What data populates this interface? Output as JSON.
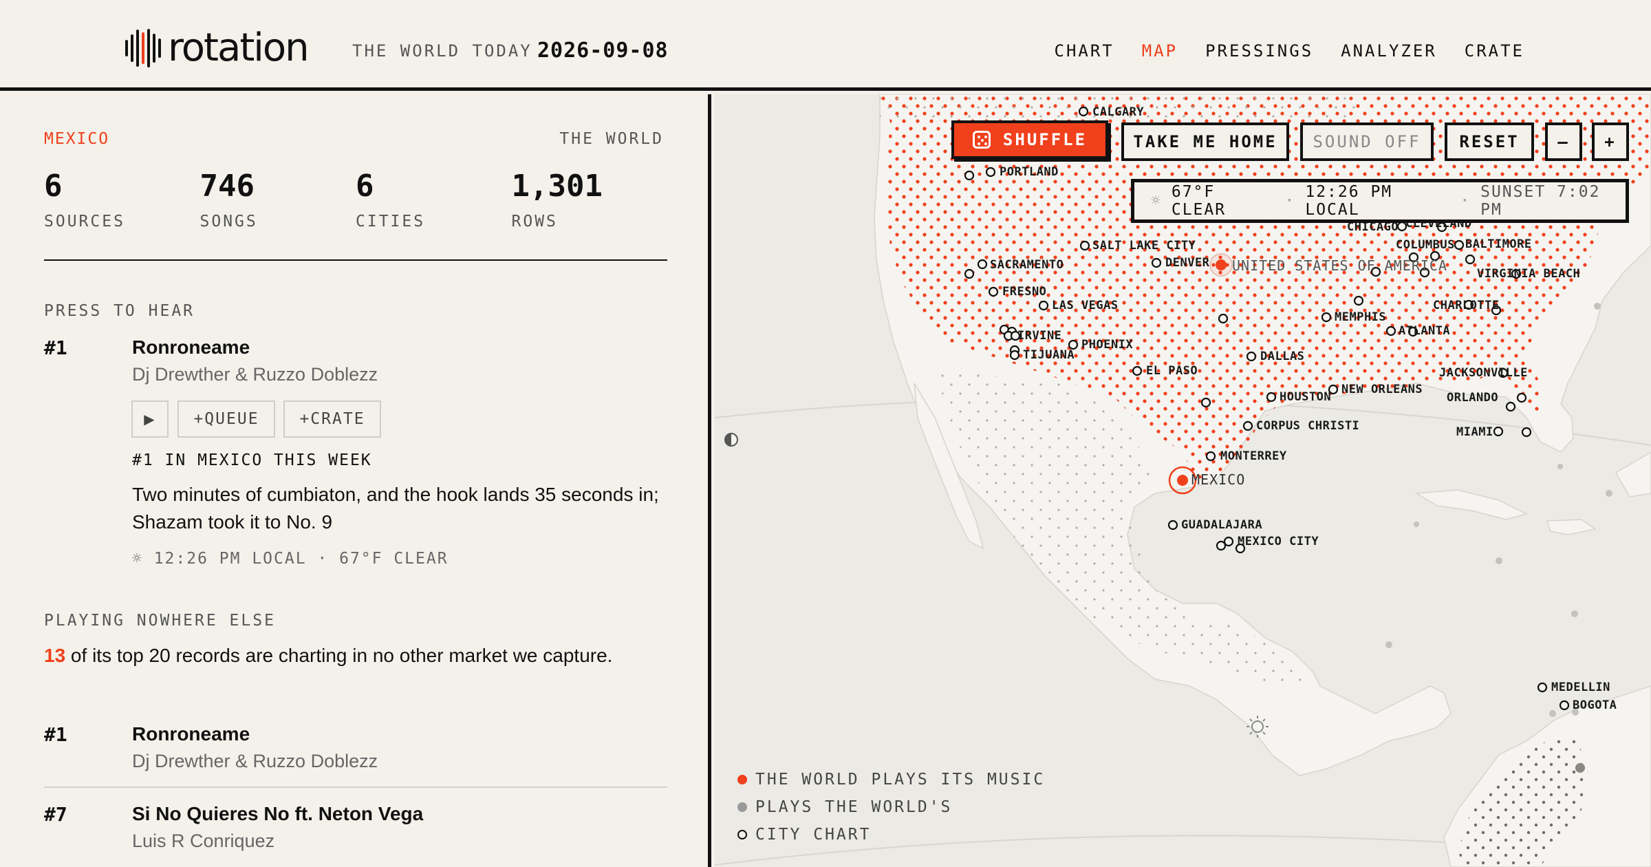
{
  "header": {
    "logo_text": "rotation",
    "tagline": "THE WORLD TODAY",
    "date": "2026-09-08",
    "nav": [
      {
        "label": "CHART",
        "active": false
      },
      {
        "label": "MAP",
        "active": true
      },
      {
        "label": "PRESSINGS",
        "active": false
      },
      {
        "label": "ANALYZER",
        "active": false
      },
      {
        "label": "CRATE",
        "active": false
      }
    ]
  },
  "panel": {
    "country": "MEXICO",
    "world_link": "THE WORLD",
    "stats": [
      {
        "value": "6",
        "label": "SOURCES"
      },
      {
        "value": "746",
        "label": "SONGS"
      },
      {
        "value": "6",
        "label": "CITIES"
      },
      {
        "value": "1,301",
        "label": "ROWS"
      }
    ],
    "press_to_hear": {
      "section_label": "PRESS TO HEAR",
      "rank": "#1",
      "title": "Ronroneame",
      "artist": "Dj Drewther & Ruzzo Doblezz",
      "play_icon": "▶",
      "queue_label": "+QUEUE",
      "crate_label": "+CRATE",
      "week_label": "#1 IN MEXICO THIS WEEK",
      "blurb": "Two minutes of cumbiaton, and the hook lands 35 seconds in; Shazam took it to No. 9",
      "local_line": "☼ 12:26 PM LOCAL · 67°F CLEAR"
    },
    "nowhere": {
      "section_label": "PLAYING NOWHERE ELSE",
      "count": "13",
      "text": " of its top 20 records are charting in no other market we capture.",
      "rows": [
        {
          "rank": "#1",
          "title": "Ronroneame",
          "artist": "Dj Drewther & Ruzzo Doblezz"
        },
        {
          "rank": "#7",
          "title": "Si No Quieres No ft. Neton Vega",
          "artist": "Luis R Conriquez"
        }
      ]
    }
  },
  "map": {
    "buttons": {
      "shuffle": "SHUFFLE",
      "home": "TAKE ME HOME",
      "sound": "SOUND OFF",
      "reset": "RESET",
      "zoom_out": "–",
      "zoom_in": "+"
    },
    "weather": {
      "icon": "☼",
      "temp": "67°F CLEAR",
      "local": "12:26 PM LOCAL",
      "sunset": "SUNSET 7:02 PM"
    },
    "colors": {
      "accent": "#f0401c",
      "ink": "#111111",
      "land": "#f5f4f0",
      "sea": "#ebeae5"
    },
    "country_labels": [
      {
        "name": "UNITED STATES OF AMERICA"
      },
      {
        "name": "MEXICO"
      }
    ],
    "cities": [
      "CALGARY",
      "PORTLAND",
      "SALT LAKE CITY",
      "DENVER",
      "SACRAMENTO",
      "FRESNO",
      "LAS VEGAS",
      "IRVINE",
      "TIJUANA",
      "PHOENIX",
      "EL PASO",
      "DALLAS",
      "HOUSTON",
      "CORPUS CHRISTI",
      "NEW ORLEANS",
      "MEMPHIS",
      "ATLANTA",
      "CHARLOTTE",
      "VIRGINIA BEACH",
      "BALTIMORE",
      "COLUMBUS",
      "CHICAGO",
      "CLEVELAND",
      "JACKSONVILLE",
      "ORLANDO",
      "MIAMI",
      "MONTERREY",
      "GUADALAJARA",
      "MEXICO CITY",
      "MEDELLIN",
      "BOGOTA"
    ],
    "legend": [
      {
        "label": "THE WORLD PLAYS ITS MUSIC",
        "type": "filled-accent"
      },
      {
        "label": "PLAYS THE WORLD'S",
        "type": "filled-grey"
      },
      {
        "label": "CITY CHART",
        "type": "ring"
      }
    ]
  }
}
